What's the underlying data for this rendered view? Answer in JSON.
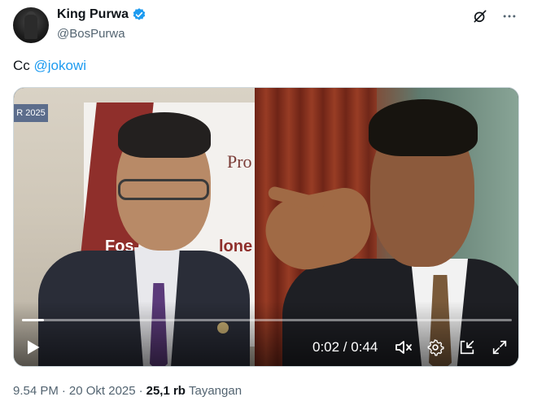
{
  "author": {
    "display_name": "King Purwa",
    "handle": "@BosPurwa",
    "verified": true,
    "verified_color": "#1d9bf0"
  },
  "tweet": {
    "text_prefix": "Cc ",
    "mention": "@jokowi",
    "mention_color": "#1d9bf0"
  },
  "media": {
    "type": "video",
    "scene_text": {
      "badge": "R 2025",
      "banner_pro": "Pro",
      "banner_fos": "Fos",
      "banner_lone": "lone"
    },
    "player": {
      "current_time": "0:02",
      "separator": " / ",
      "duration": "0:44",
      "time_display": "0:02 / 0:44",
      "progress_fraction": 0.045,
      "icons": [
        "play-icon",
        "mute-icon",
        "settings-icon",
        "picture-in-picture-icon",
        "fullscreen-icon"
      ]
    }
  },
  "header_actions": {
    "icons": [
      "grok-icon",
      "more-icon"
    ]
  },
  "footer": {
    "time": "9.54 PM",
    "dot": "·",
    "date": "20 Okt 2025",
    "views_count": "25,1 rb",
    "views_label": "Tayangan"
  }
}
